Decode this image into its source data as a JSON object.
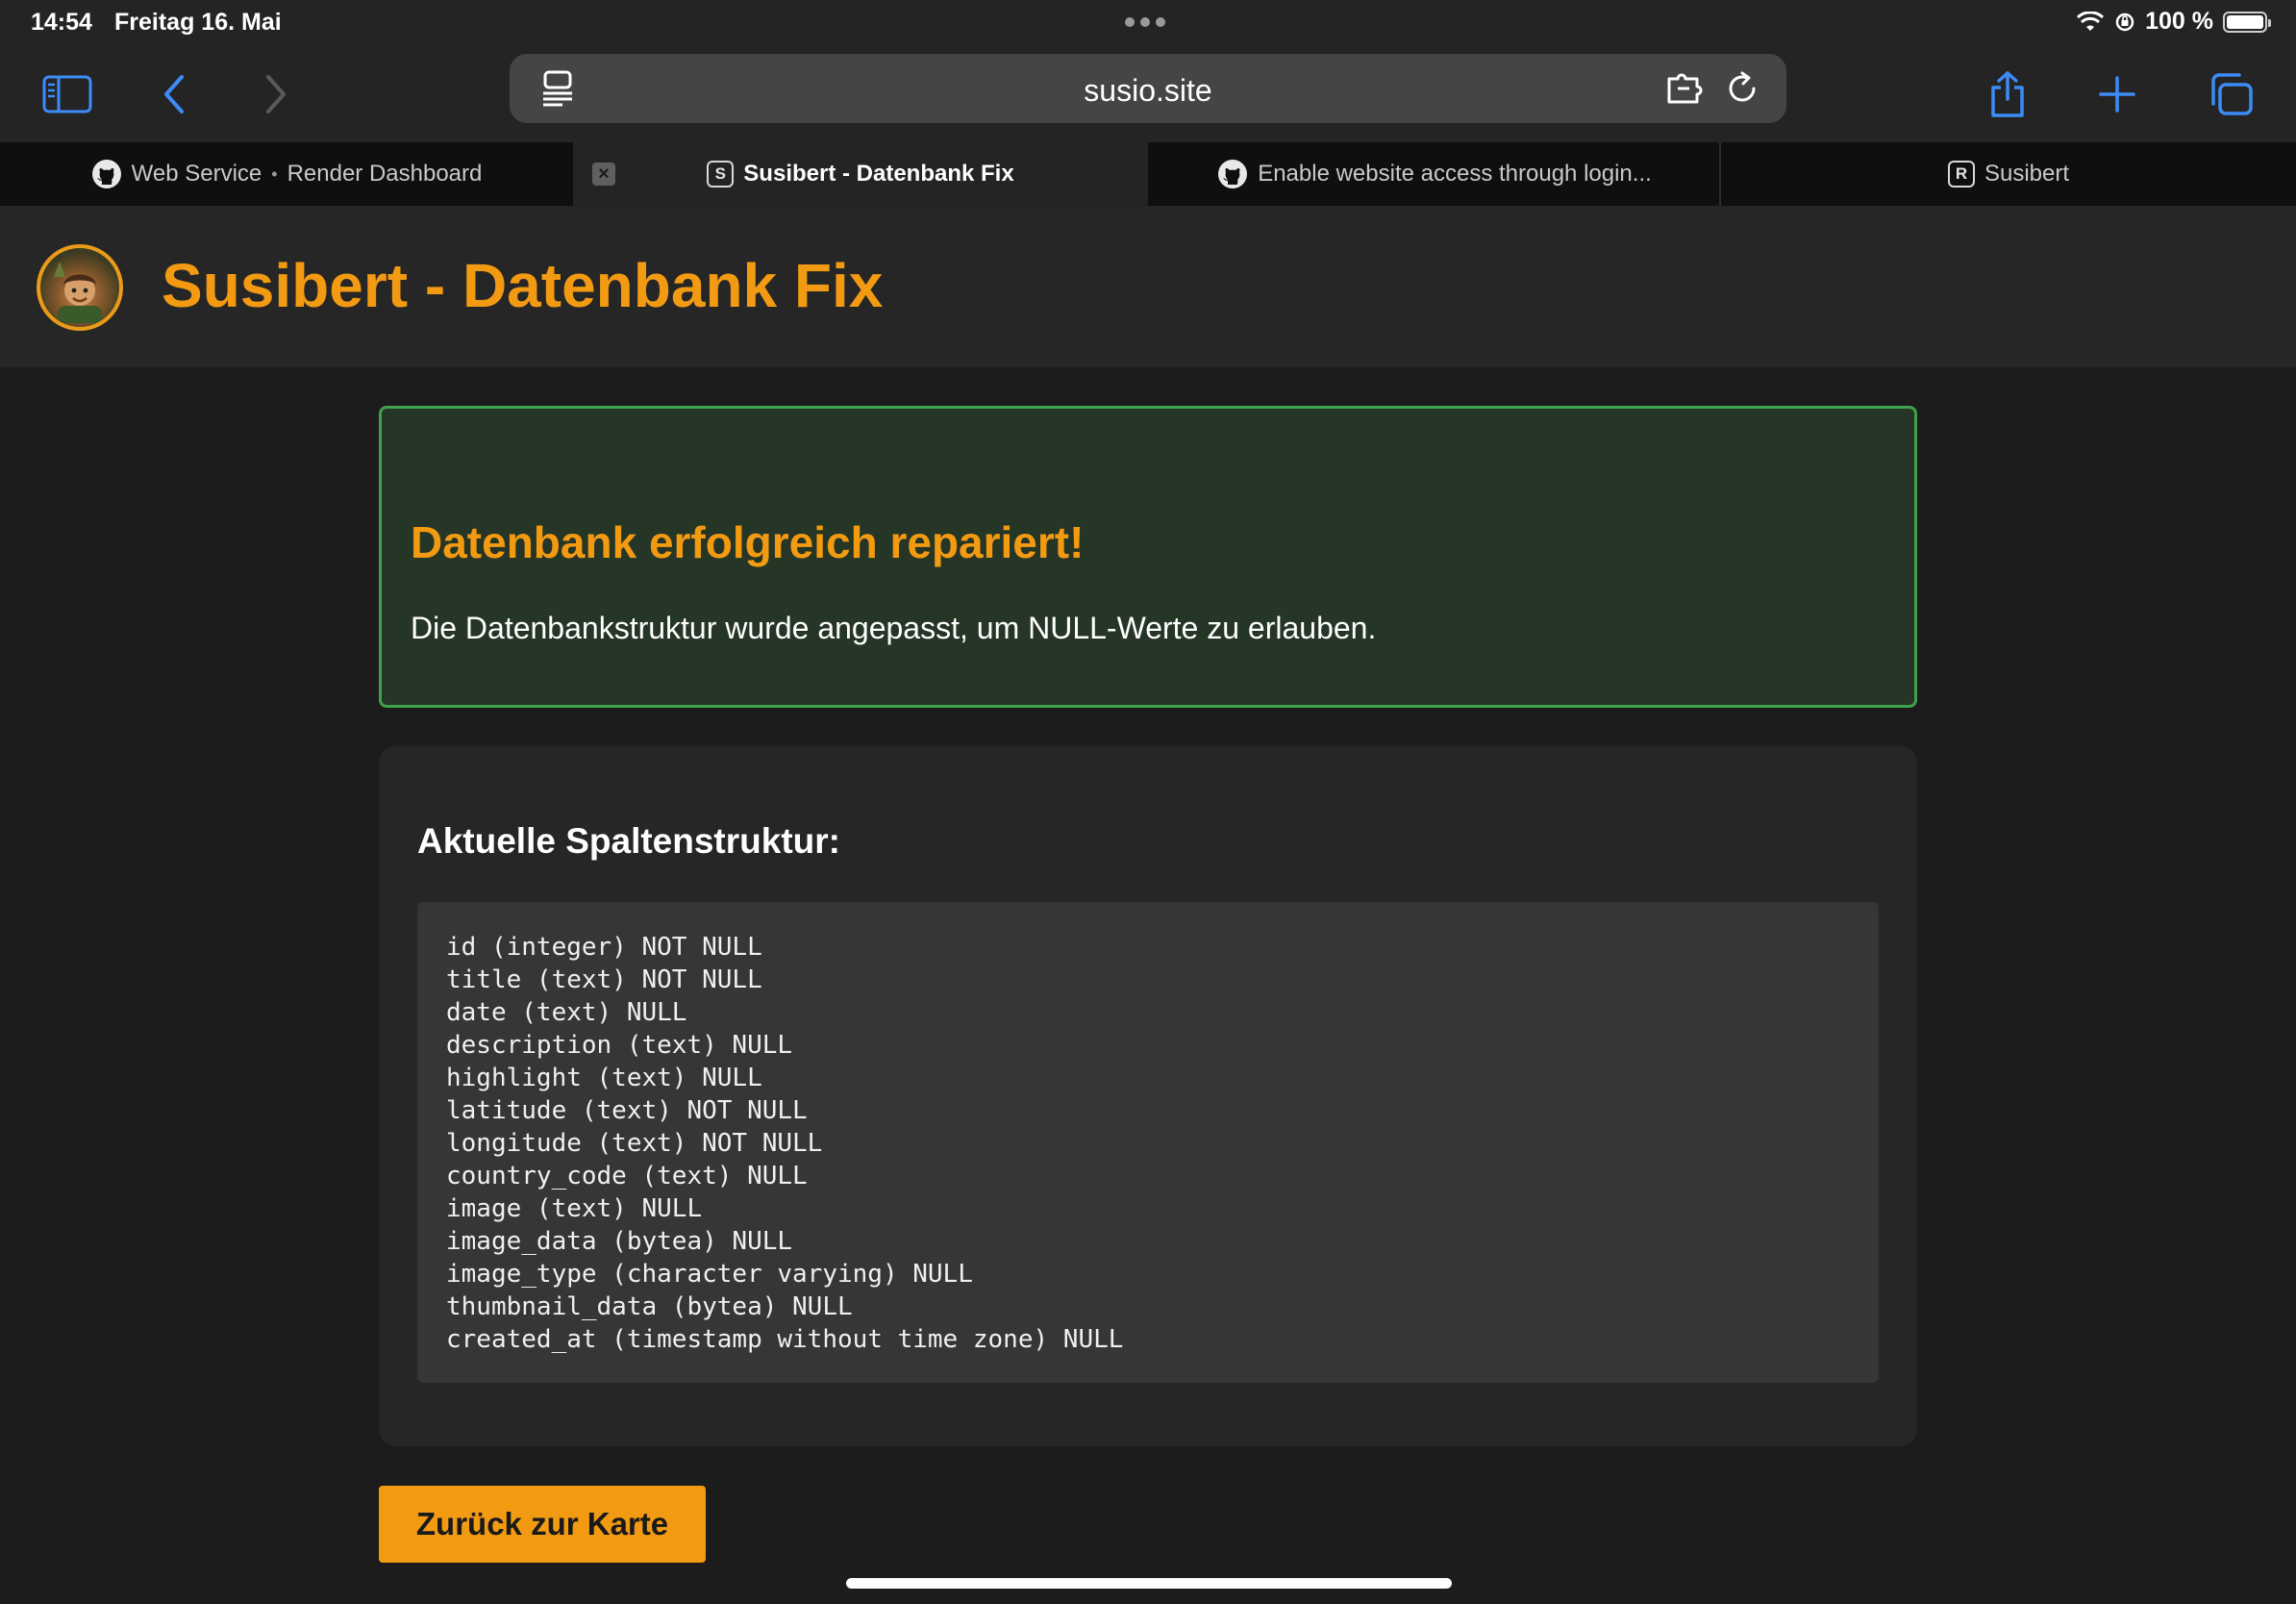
{
  "status_bar": {
    "time": "14:54",
    "date": "Freitag 16. Mai",
    "battery": "100 %",
    "battery_level": 1.0
  },
  "toolbar": {
    "url": "susio.site",
    "icons": [
      "sidebar-icon",
      "back-icon",
      "forward-icon",
      "reader-icon",
      "extension-icon",
      "reload-icon",
      "share-icon",
      "plus-icon",
      "tabs-icon"
    ],
    "accent_color": "#3d8bf7"
  },
  "tabs": [
    {
      "title": "Web Service",
      "subtitle": "Render Dashboard",
      "separator": "•",
      "icon": "github-icon"
    },
    {
      "title": "Susibert - Datenbank Fix",
      "badge": "S",
      "active": true
    },
    {
      "title": "Enable website access through login...",
      "icon": "github-icon"
    },
    {
      "title": "Susibert",
      "badge": "R"
    }
  ],
  "header": {
    "title": "Susibert - Datenbank Fix",
    "brand_color": "#f29a12"
  },
  "success": {
    "title": "Datenbank erfolgreich repariert!",
    "message": "Die Datenbankstruktur wurde angepasst, um NULL-Werte zu erlauben.",
    "border_color": "#3fa24c"
  },
  "structure": {
    "title": "Aktuelle Spaltenstruktur:",
    "columns": [
      "id (integer) NOT NULL",
      "title (text) NOT NULL",
      "date (text) NULL",
      "description (text) NULL",
      "highlight (text) NULL",
      "latitude (text) NOT NULL",
      "longitude (text) NOT NULL",
      "country_code (text) NULL",
      "image (text) NULL",
      "image_data (bytea) NULL",
      "image_type (character varying) NULL",
      "thumbnail_data (bytea) NULL",
      "created_at (timestamp without time zone) NULL"
    ]
  },
  "actions": {
    "back_label": "Zurück zur Karte"
  }
}
